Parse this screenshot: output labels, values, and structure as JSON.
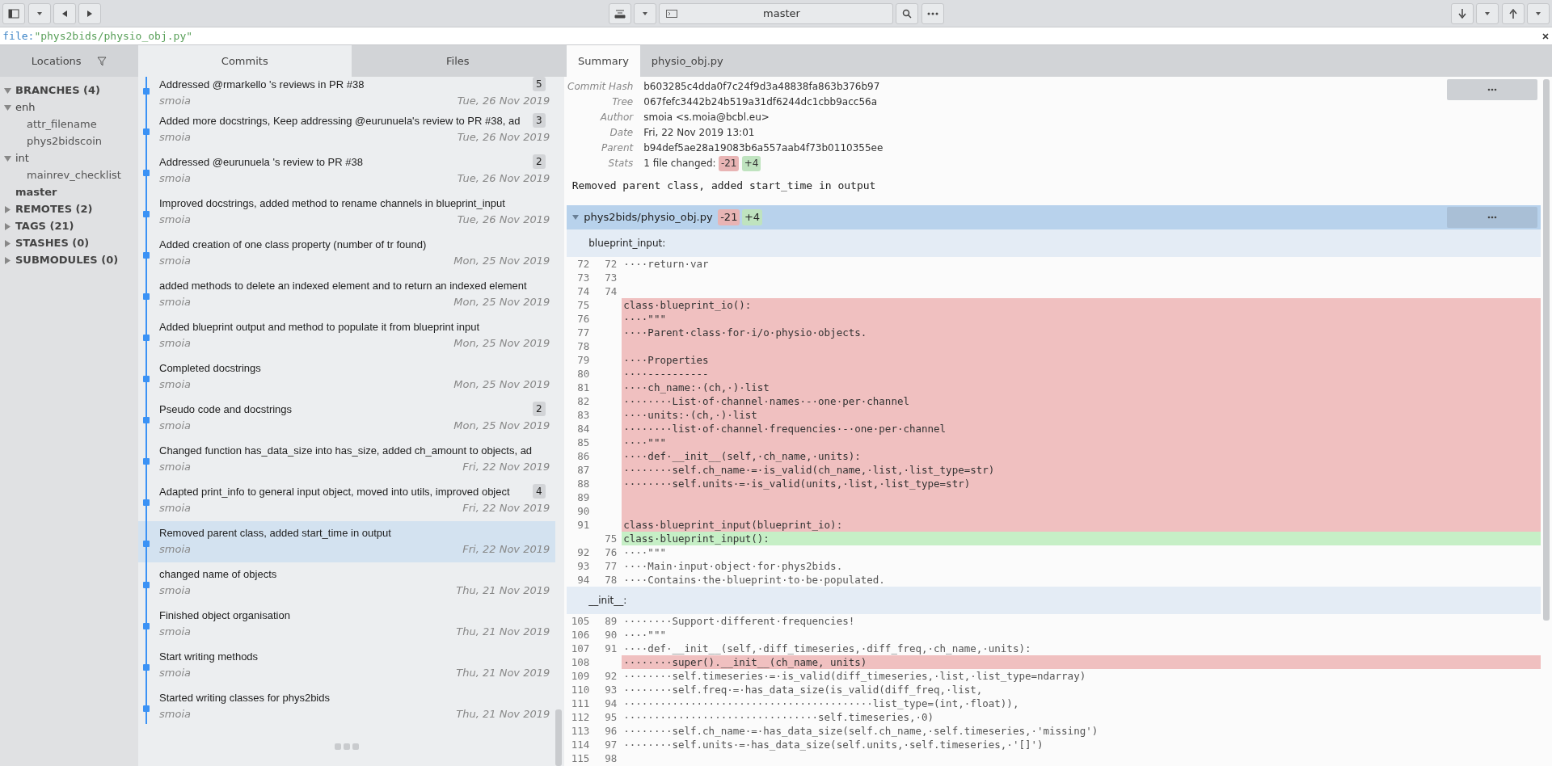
{
  "toolbar": {
    "branch": "master"
  },
  "search": {
    "prefix": "file:",
    "value": "\"phys2bids/physio_obj.py\""
  },
  "locations": {
    "title": "Locations",
    "tree": [
      {
        "label": "BRANCHES (4)",
        "expanded": true,
        "children": [
          {
            "label": "enh",
            "expanded": true,
            "children": [
              {
                "label": "attr_filename"
              },
              {
                "label": "phys2bidscoin"
              }
            ]
          },
          {
            "label": "int",
            "expanded": true,
            "children": [
              {
                "label": "mainrev_checklist"
              }
            ]
          },
          {
            "label": "master",
            "current": true
          }
        ]
      },
      {
        "label": "REMOTES (2)",
        "expanded": false
      },
      {
        "label": "TAGS (21)",
        "expanded": false
      },
      {
        "label": "STASHES (0)",
        "expanded": false
      },
      {
        "label": "SUBMODULES (0)",
        "expanded": false
      }
    ]
  },
  "list_tabs": [
    {
      "label": "Commits",
      "selected": true
    },
    {
      "label": "Files",
      "selected": false
    }
  ],
  "commits": [
    {
      "message": "Addressed @rmarkello 's reviews in PR #38",
      "author": "smoia",
      "date": "Tue, 26 Nov 2019",
      "badge": "5",
      "selected": false
    },
    {
      "message": "Added more docstrings, Keep addressing @eurunuela's review to PR #38, ad",
      "author": "smoia",
      "date": "Tue, 26 Nov 2019",
      "badge": "3",
      "selected": false
    },
    {
      "message": "Addressed @eurunuela 's review to PR #38",
      "author": "smoia",
      "date": "Tue, 26 Nov 2019",
      "badge": "2",
      "selected": false
    },
    {
      "message": "Improved docstrings, added method to rename channels in blueprint_input",
      "author": "smoia",
      "date": "Tue, 26 Nov 2019",
      "selected": false
    },
    {
      "message": "Added creation of one class property (number of tr found)",
      "author": "smoia",
      "date": "Mon, 25 Nov 2019",
      "selected": false
    },
    {
      "message": "added methods to delete an indexed element and to return an indexed element",
      "author": "smoia",
      "date": "Mon, 25 Nov 2019",
      "selected": false
    },
    {
      "message": "Added blueprint output and method to populate it from blueprint input",
      "author": "smoia",
      "date": "Mon, 25 Nov 2019",
      "selected": false
    },
    {
      "message": "Completed docstrings",
      "author": "smoia",
      "date": "Mon, 25 Nov 2019",
      "selected": false
    },
    {
      "message": "Pseudo code and docstrings",
      "author": "smoia",
      "date": "Mon, 25 Nov 2019",
      "badge": "2",
      "selected": false
    },
    {
      "message": "Changed function has_data_size into has_size, added ch_amount to objects, ad",
      "author": "smoia",
      "date": "Fri, 22 Nov 2019",
      "selected": false
    },
    {
      "message": "Adapted print_info to general input object, moved into utils, improved object",
      "author": "smoia",
      "date": "Fri, 22 Nov 2019",
      "badge": "4",
      "selected": false
    },
    {
      "message": "Removed parent class, added start_time in output",
      "author": "smoia",
      "date": "Fri, 22 Nov 2019",
      "selected": true
    },
    {
      "message": "changed name of objects",
      "author": "smoia",
      "date": "Thu, 21 Nov 2019",
      "selected": false
    },
    {
      "message": "Finished object organisation",
      "author": "smoia",
      "date": "Thu, 21 Nov 2019",
      "selected": false
    },
    {
      "message": "Start writing methods",
      "author": "smoia",
      "date": "Thu, 21 Nov 2019",
      "selected": false
    },
    {
      "message": "Started writing classes for phys2bids",
      "author": "smoia",
      "date": "Thu, 21 Nov 2019",
      "selected": false
    }
  ],
  "detail_tabs": [
    {
      "label": "Summary",
      "selected": true
    },
    {
      "label": "physio_obj.py",
      "selected": false
    }
  ],
  "summary": {
    "fields": [
      {
        "key": "Commit Hash",
        "value": "b603285c4dda0f7c24f9d3a48838fa863b376b97"
      },
      {
        "key": "Tree",
        "value": "067fefc3442b24b519a31df6244dc1cbb9acc56a"
      },
      {
        "key": "Author",
        "value": "smoia <s.moia@bcbl.eu>"
      },
      {
        "key": "Date",
        "value": "Fri, 22 Nov 2019 13:01"
      },
      {
        "key": "Parent",
        "value": "b94def5ae28a19083b6a557aab4f73b0110355ee"
      }
    ],
    "stats": {
      "key": "Stats",
      "text": "1 file changed:",
      "removed": "-21",
      "added": "+4"
    },
    "message": "Removed parent class, added start_time in output"
  },
  "file": {
    "path": "phys2bids/physio_obj.py",
    "expanded": true,
    "removed": "-21",
    "added": "+4",
    "hunks": [
      {
        "header": "blueprint_input:",
        "lines": [
          {
            "kind": "context",
            "old": "72",
            "new": "72",
            "text": "····return·var"
          },
          {
            "kind": "context",
            "old": "73",
            "new": "73"
          },
          {
            "kind": "context",
            "old": "74",
            "new": "74"
          },
          {
            "kind": "removed",
            "old": "75",
            "text": "class·blueprint_io():"
          },
          {
            "kind": "removed",
            "old": "76",
            "text": "····\"\"\""
          },
          {
            "kind": "removed",
            "old": "77",
            "text": "····Parent·class·for·i/o·physio·objects."
          },
          {
            "kind": "removed",
            "old": "78"
          },
          {
            "kind": "removed",
            "old": "79",
            "text": "····Properties"
          },
          {
            "kind": "removed",
            "old": "80",
            "text": "····----------"
          },
          {
            "kind": "removed",
            "old": "81",
            "text": "····ch_name:·(ch,·)·list"
          },
          {
            "kind": "removed",
            "old": "82",
            "text": "········List·of·channel·names·-·one·per·channel"
          },
          {
            "kind": "removed",
            "old": "83",
            "text": "····units:·(ch,·)·list"
          },
          {
            "kind": "removed",
            "old": "84",
            "text": "········list·of·channel·frequencies·-·one·per·channel"
          },
          {
            "kind": "removed",
            "old": "85",
            "text": "····\"\"\""
          },
          {
            "kind": "removed",
            "old": "86",
            "text": "····def·__init__(self,·ch_name,·units):"
          },
          {
            "kind": "removed",
            "old": "87",
            "text": "········self.ch_name·=·is_valid(ch_name,·list,·list_type=str)"
          },
          {
            "kind": "removed",
            "old": "88",
            "text": "········self.units·=·is_valid(units,·list,·list_type=str)"
          },
          {
            "kind": "removed",
            "old": "89"
          },
          {
            "kind": "removed",
            "old": "90"
          },
          {
            "kind": "removed",
            "old": "91",
            "text": "class·blueprint_input(blueprint_io):"
          },
          {
            "kind": "added",
            "new": "75",
            "text": "class·blueprint_input():"
          },
          {
            "kind": "context",
            "old": "92",
            "new": "76",
            "text": "····\"\"\""
          },
          {
            "kind": "context",
            "old": "93",
            "new": "77",
            "text": "····Main·input·object·for·phys2bids."
          },
          {
            "kind": "context",
            "old": "94",
            "new": "78",
            "text": "····Contains·the·blueprint·to·be·populated."
          }
        ]
      },
      {
        "header": "__init__:",
        "lines": [
          {
            "kind": "context",
            "old": "105",
            "new": "89",
            "text": "········Support·different·frequencies!"
          },
          {
            "kind": "context",
            "old": "106",
            "new": "90",
            "text": "····\"\"\""
          },
          {
            "kind": "context",
            "old": "107",
            "new": "91",
            "text": "····def·__init__(self,·diff_timeseries,·diff_freq,·ch_name,·units):"
          },
          {
            "kind": "removed",
            "old": "108",
            "text": "········super().__init__(ch_name, units)"
          },
          {
            "kind": "context",
            "old": "109",
            "new": "92",
            "text": "········self.timeseries·=·is_valid(diff_timeseries,·list,·list_type=ndarray)"
          },
          {
            "kind": "context",
            "old": "110",
            "new": "93",
            "text": "········self.freq·=·has_data_size(is_valid(diff_freq,·list,"
          },
          {
            "kind": "context",
            "old": "111",
            "new": "94",
            "text": "·········································list_type=(int,·float)),"
          },
          {
            "kind": "context",
            "old": "112",
            "new": "95",
            "text": "································self.timeseries,·0)"
          },
          {
            "kind": "context",
            "old": "113",
            "new": "96",
            "text": "········self.ch_name·=·has_data_size(self.ch_name,·self.timeseries,·'missing')"
          },
          {
            "kind": "context",
            "old": "114",
            "new": "97",
            "text": "········self.units·=·has_data_size(self.units,·self.timeseries,·'[]')"
          },
          {
            "kind": "context",
            "old": "115",
            "new": "98"
          }
        ]
      }
    ]
  }
}
